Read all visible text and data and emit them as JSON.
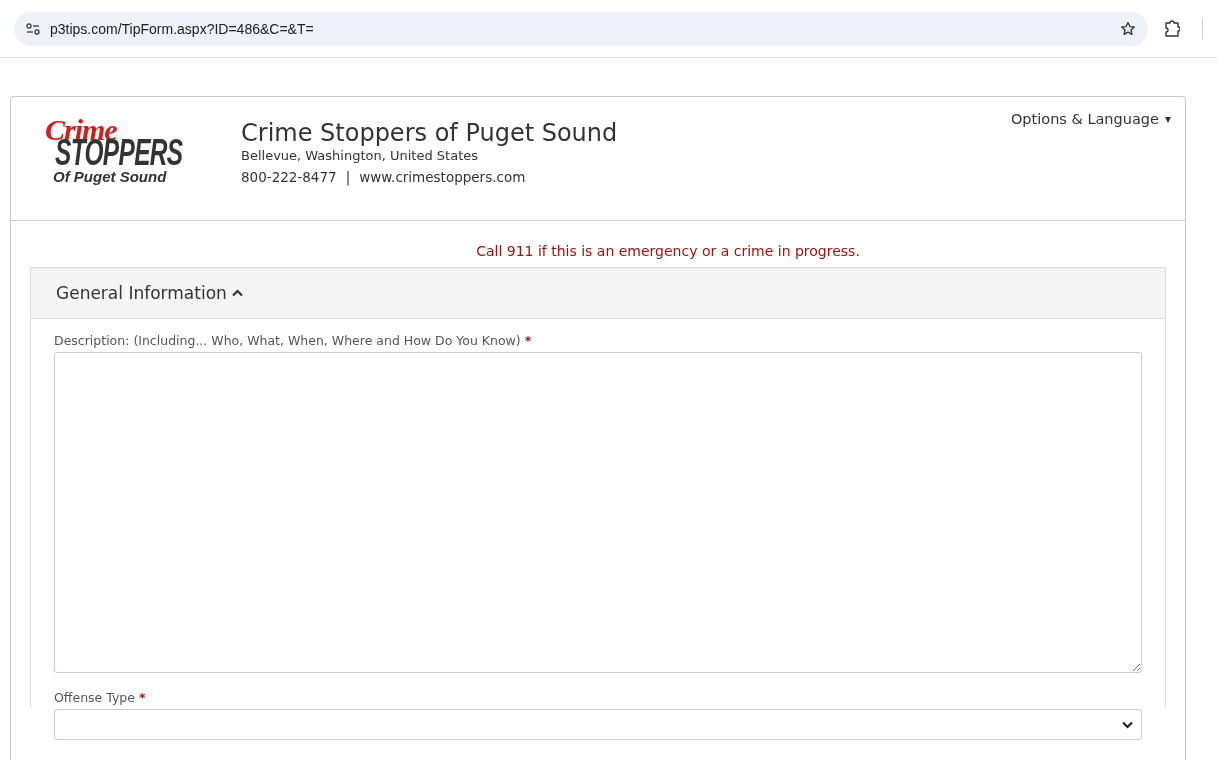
{
  "browser": {
    "url": "p3tips.com/TipForm.aspx?ID=486&C=&T="
  },
  "header": {
    "logo": {
      "script": "Crime",
      "title": "STOPPERS",
      "subtitle": "Of Puget Sound"
    },
    "org_name": "Crime Stoppers of Puget Sound",
    "location": "Bellevue, Washington, United States",
    "phone": "800-222-8477",
    "separator": "|",
    "website": "www.crimestoppers.com",
    "menu": {
      "label": "Options & Language",
      "caret": "▾"
    }
  },
  "alert": "Call 911 if this is an emergency or a crime in progress.",
  "section": {
    "title": "General Information",
    "expanded": true,
    "fields": [
      {
        "kind": "textarea",
        "label": "Description: (Including... Who, What, When, Where and How Do You Know)",
        "required": true,
        "required_mark": "*"
      },
      {
        "kind": "select",
        "label": "Offense Type",
        "required": true,
        "required_mark": "*"
      }
    ]
  }
}
